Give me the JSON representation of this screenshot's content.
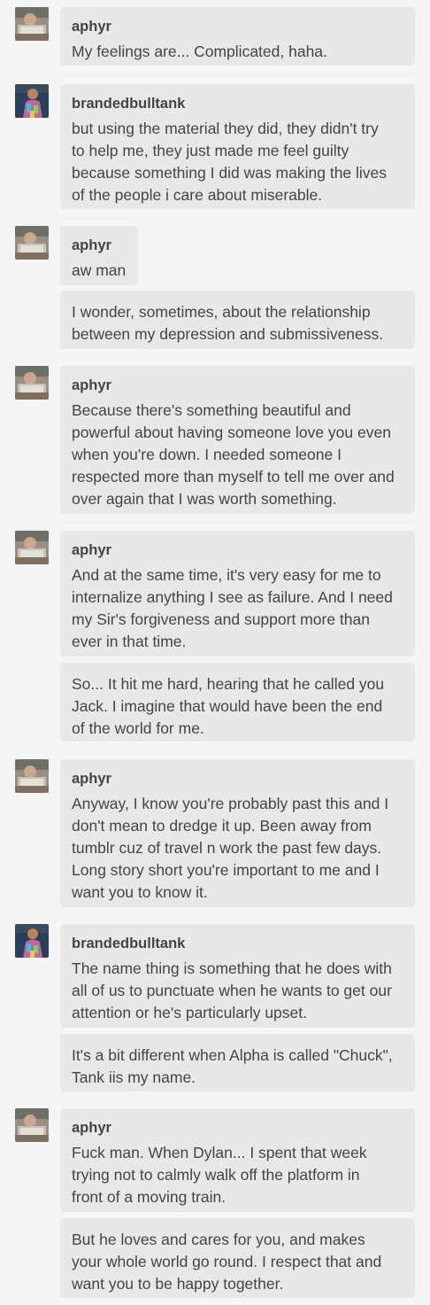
{
  "messages": [
    {
      "user": "aphyr",
      "avatar": "aphyr-avatar-icon",
      "text": "My feelings are... Complicated, haha."
    },
    {
      "user": "brandedbulltank",
      "avatar": "brandedbulltank-avatar-icon",
      "text": "but using the material they did, they didn't try\nto help me, they just made me feel guilty\nbecause something I did was making the lives\nof the people i care about miserable."
    },
    {
      "user": "aphyr",
      "avatar": "aphyr-avatar-icon",
      "text": "aw man"
    },
    {
      "user": "",
      "text": "I wonder, sometimes, about the relationship\nbetween my depression and submissiveness."
    },
    {
      "user": "aphyr",
      "avatar": "aphyr-avatar-icon",
      "text": "Because there's something beautiful and\npowerful about having someone love you even\nwhen you're down. I needed someone I\nrespected more than myself to tell me over and\nover again that I was worth something."
    },
    {
      "user": "aphyr",
      "avatar": "aphyr-avatar-icon",
      "text": "And at the same time, it's very easy for me to\ninternalize anything I see as failure. And I need\nmy Sir's forgiveness and support more than\never in that time."
    },
    {
      "user": "",
      "text": "So... It hit me hard, hearing that he called you\nJack. I imagine that would have been the end\nof the world for me."
    },
    {
      "user": "aphyr",
      "avatar": "aphyr-avatar-icon",
      "text": "Anyway, I know you're probably past this and I\ndon't mean to dredge it up. Been away from\ntumblr cuz of travel n work the past few days.\nLong story short you're important to me and I\nwant you to know it."
    },
    {
      "user": "brandedbulltank",
      "avatar": "brandedbulltank-avatar-icon",
      "text": "The name thing is something that he does with\nall of us to punctuate when he wants to get our\nattention or he's particularly upset."
    },
    {
      "user": "",
      "text": "It's a bit different when Alpha is called \"Chuck\",\nTank iis my name."
    },
    {
      "user": "aphyr",
      "avatar": "aphyr-avatar-icon",
      "text": "Fuck man. When Dylan... I spent that week\ntrying not to calmly walk off the platform in\nfront of a moving train."
    },
    {
      "user": "",
      "text": "But he loves and cares for you, and makes\nyour whole world go round. I respect that and\nwant you to be happy together."
    }
  ]
}
